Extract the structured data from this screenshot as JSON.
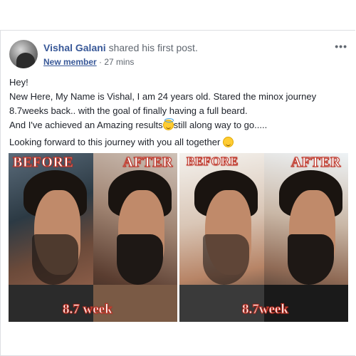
{
  "post": {
    "author": "Vishal Galani",
    "action": "shared his first post.",
    "role": "New member",
    "separator": " · ",
    "time": "27 mins",
    "more": "•••",
    "lines": {
      "l1": "Hey!",
      "l2": "New Here, My Name is Vishal, I am 24 years old. Stared the minox journey",
      "l3": "8.7weeks back.. with the goal of finally having a full beard.",
      "l4a": "And I've achieved an Amazing results",
      "l4b": "still along way to go.....",
      "l5": "Looking forward to this journey with you all together "
    }
  },
  "images": {
    "panel1": {
      "before": "BEFORE",
      "after": "AFTER",
      "week": "8.7 week"
    },
    "panel2": {
      "before": "BEFORE",
      "after": "AFTER",
      "week": "8.7week"
    }
  }
}
